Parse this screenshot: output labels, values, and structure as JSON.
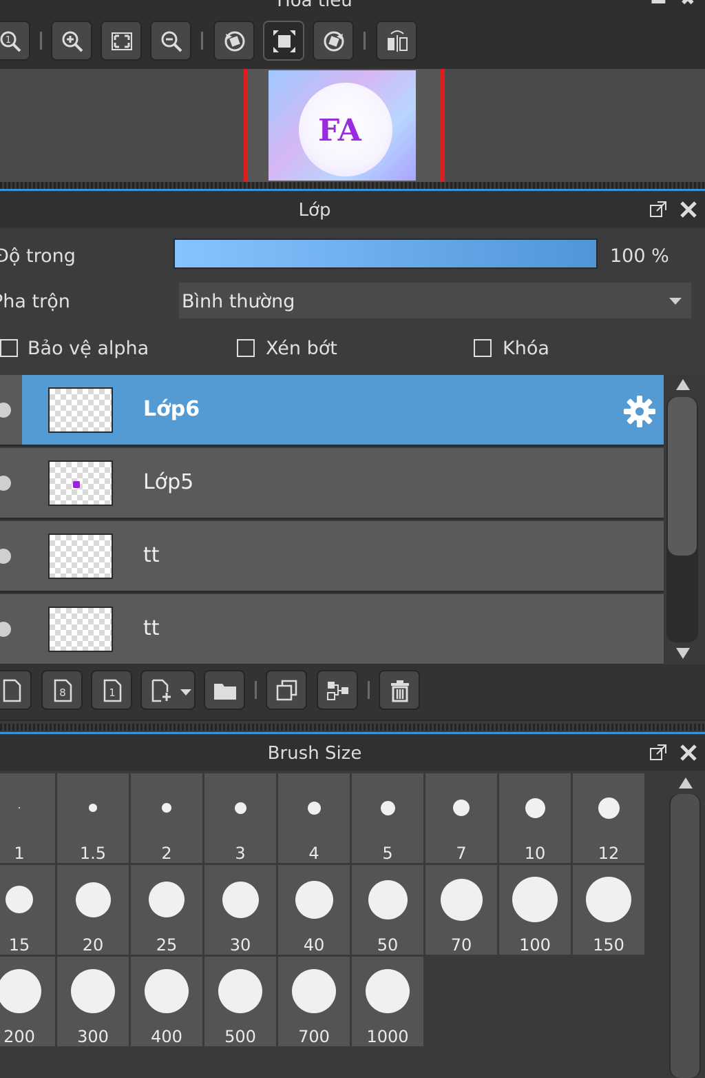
{
  "navigator": {
    "title": "Hoa tiêu"
  },
  "layers_panel": {
    "title": "Lớp",
    "opacity_label": "Độ trong",
    "opacity_value": 100,
    "opacity_text": "100 %",
    "blend_label": "Pha trộn",
    "blend_value": "Bình thường",
    "checkboxes": [
      {
        "label": "Bảo vệ alpha",
        "checked": false
      },
      {
        "label": "Xén bớt",
        "checked": false
      },
      {
        "label": "Khóa",
        "checked": false
      }
    ],
    "layers": [
      {
        "name": "Lớp6",
        "selected": true
      },
      {
        "name": "Lớp5",
        "selected": false
      },
      {
        "name": "tt",
        "selected": false
      },
      {
        "name": "tt",
        "selected": false
      }
    ]
  },
  "brush_panel": {
    "title": "Brush Size",
    "sizes": [
      "1",
      "1.5",
      "2",
      "3",
      "4",
      "5",
      "7",
      "10",
      "12",
      "15",
      "20",
      "25",
      "30",
      "40",
      "50",
      "70",
      "100",
      "150",
      "200",
      "300",
      "400",
      "500",
      "700",
      "1000"
    ]
  },
  "colors": {
    "accent": "#549bd3",
    "marker_red": "#e01b1b",
    "panel_bg": "#3a3a3a"
  }
}
